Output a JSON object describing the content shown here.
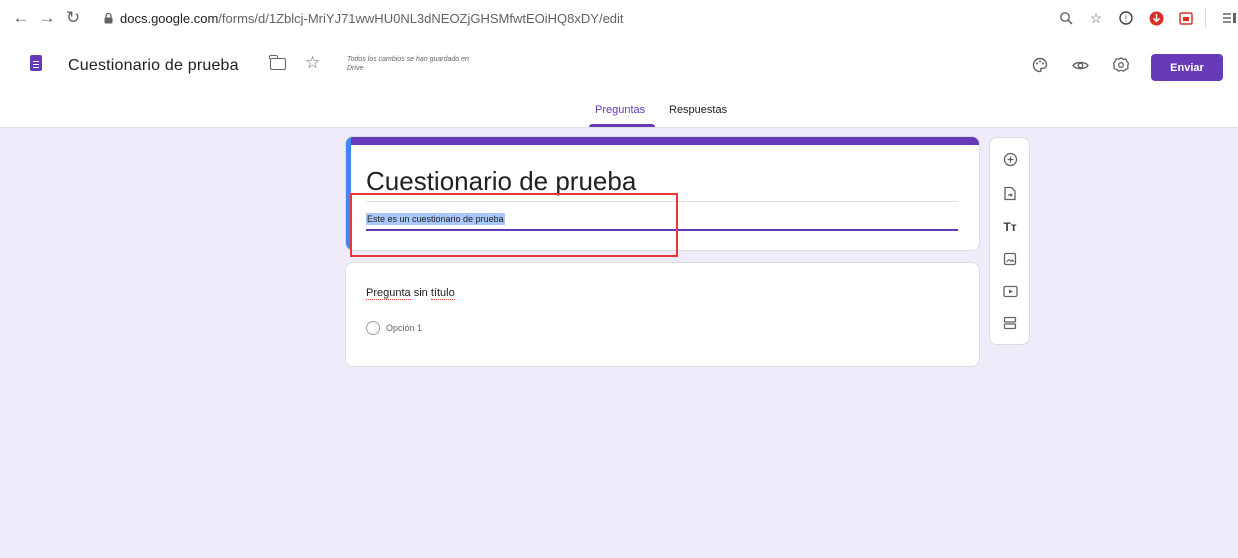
{
  "browser": {
    "back_icon": "arrow-left-icon",
    "forward_icon": "arrow-right-icon",
    "reload_icon": "reload-icon",
    "url_host": "docs.google.com",
    "url_path": "/forms/d/1Zblcj-MriYJ71wwHU0NL3dNEOZjGHSMfwtEOiHQ8xDY/edit"
  },
  "header": {
    "title": "Cuestionario de prueba",
    "save_status": "Todos los cambios se han guardado en Drive",
    "send_label": "Enviar"
  },
  "tabs": [
    {
      "label": "Preguntas",
      "active": true
    },
    {
      "label": "Respuestas",
      "active": false
    }
  ],
  "form": {
    "title": "Cuestionario de prueba",
    "description": "Este es un cuestionario de prueba"
  },
  "question": {
    "title_word1": "Pregunta",
    "title_word2": "sin",
    "title_word3": "título",
    "option_label": "Opción 1"
  },
  "colors": {
    "accent": "#673ab7",
    "background": "#f0ebf8",
    "highlight_box": "#e53935"
  }
}
